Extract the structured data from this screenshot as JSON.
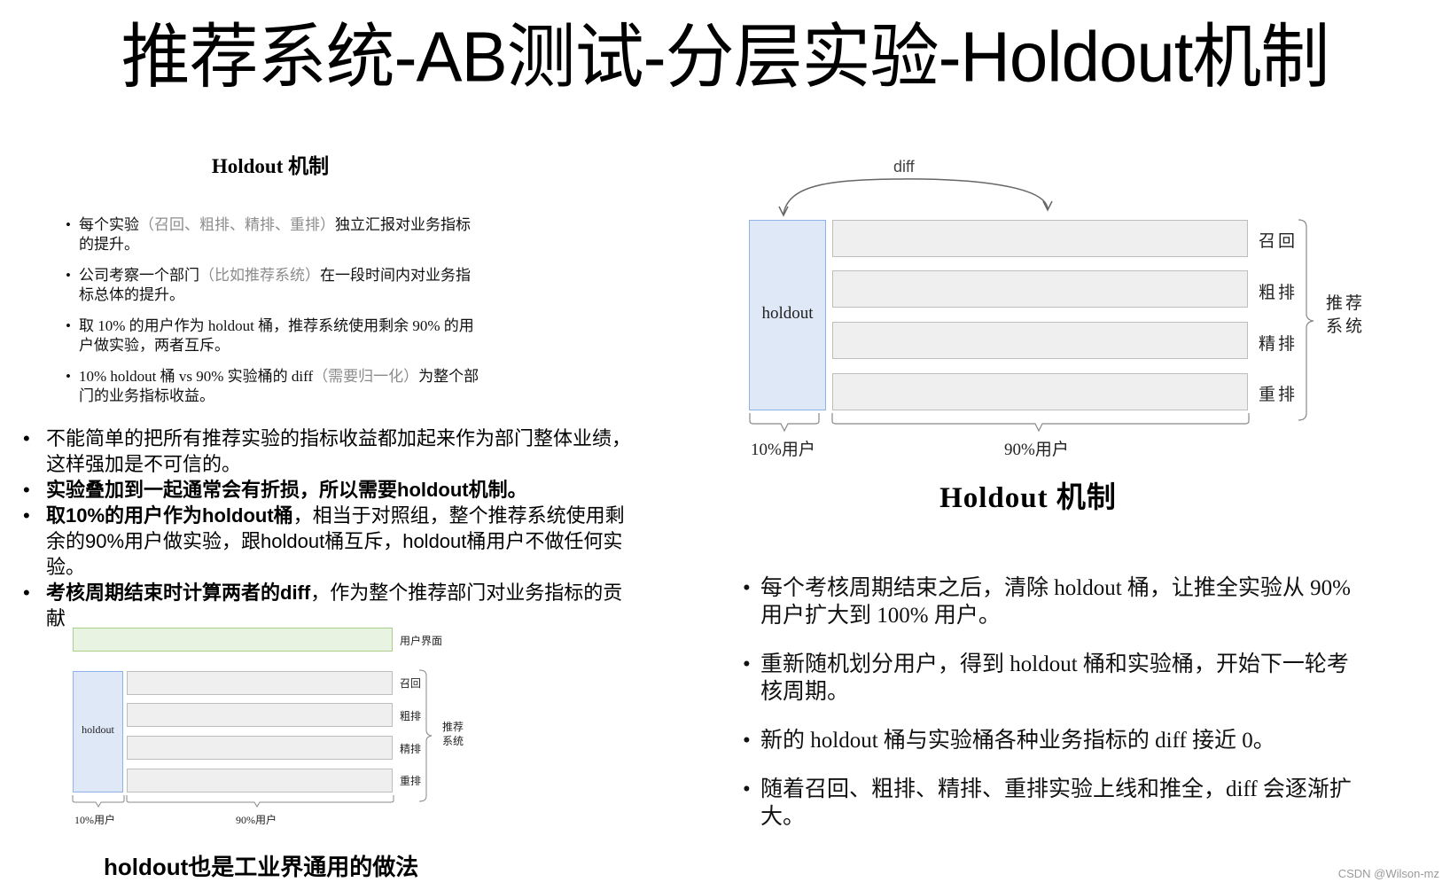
{
  "title": "推荐系统-AB测试-分层实验-Holdout机制",
  "left_panel": {
    "heading": "Holdout 机制",
    "bullets": [
      {
        "pre": "每个实验",
        "muted": "（召回、粗排、精排、重排）",
        "post": "独立汇报对业务指标的提升。"
      },
      {
        "pre": "公司考察一个部门",
        "muted": "（比如推荐系统）",
        "post": "在一段时间内对业务指标总体的提升。"
      },
      {
        "pre": "取 10% 的用户作为 holdout 桶，推荐系统使用剩余 90% 的用户做实验，两者互斥。",
        "muted": "",
        "post": ""
      },
      {
        "pre": "10% holdout 桶 vs 90% 实验桶的 diff",
        "muted": "（需要归一化）",
        "post": "为整个部门的业务指标收益。"
      }
    ]
  },
  "main_bullets": [
    {
      "bold": "",
      "text": "不能简单的把所有推荐实验的指标收益都加起来作为部门整体业绩，这样强加是不可信的。"
    },
    {
      "bold": "实验叠加到一起通常会有折损，所以需要holdout机制。",
      "text": ""
    },
    {
      "bold": "取10%的用户作为holdout桶",
      "text": "，相当于对照组，整个推荐系统使用剩余的90%用户做实验，跟holdout桶互斥，holdout桶用户不做任何实验。"
    },
    {
      "bold": "考核周期结束时计算两者的diff",
      "text": "，作为整个推荐部门对业务指标的贡献"
    }
  ],
  "small_diagram": {
    "ui_label": "用户界面",
    "holdout_label": "holdout",
    "layers": [
      "召回",
      "粗排",
      "精排",
      "重排"
    ],
    "group_label_1": "推荐",
    "group_label_2": "系统",
    "split_holdout": "10%用户",
    "split_experiment": "90%用户"
  },
  "footer_note": "holdout也是工业界通用的做法",
  "right_diagram": {
    "diff_label": "diff",
    "holdout_label": "holdout",
    "layers": [
      "召回",
      "粗排",
      "精排",
      "重排"
    ],
    "group_label_1": "推荐",
    "group_label_2": "系统",
    "split_holdout": "10%用户",
    "split_experiment": "90%用户",
    "caption": "Holdout 机制"
  },
  "right_bullets": [
    "每个考核周期结束之后，清除 holdout 桶，让推全实验从 90% 用户扩大到 100% 用户。",
    "重新随机划分用户，得到 holdout 桶和实验桶，开始下一轮考核周期。",
    "新的 holdout 桶与实验桶各种业务指标的 diff 接近 0。",
    "随着召回、粗排、精排、重排实验上线和推全，diff 会逐渐扩大。"
  ],
  "watermark": "CSDN @Wilson-mz"
}
